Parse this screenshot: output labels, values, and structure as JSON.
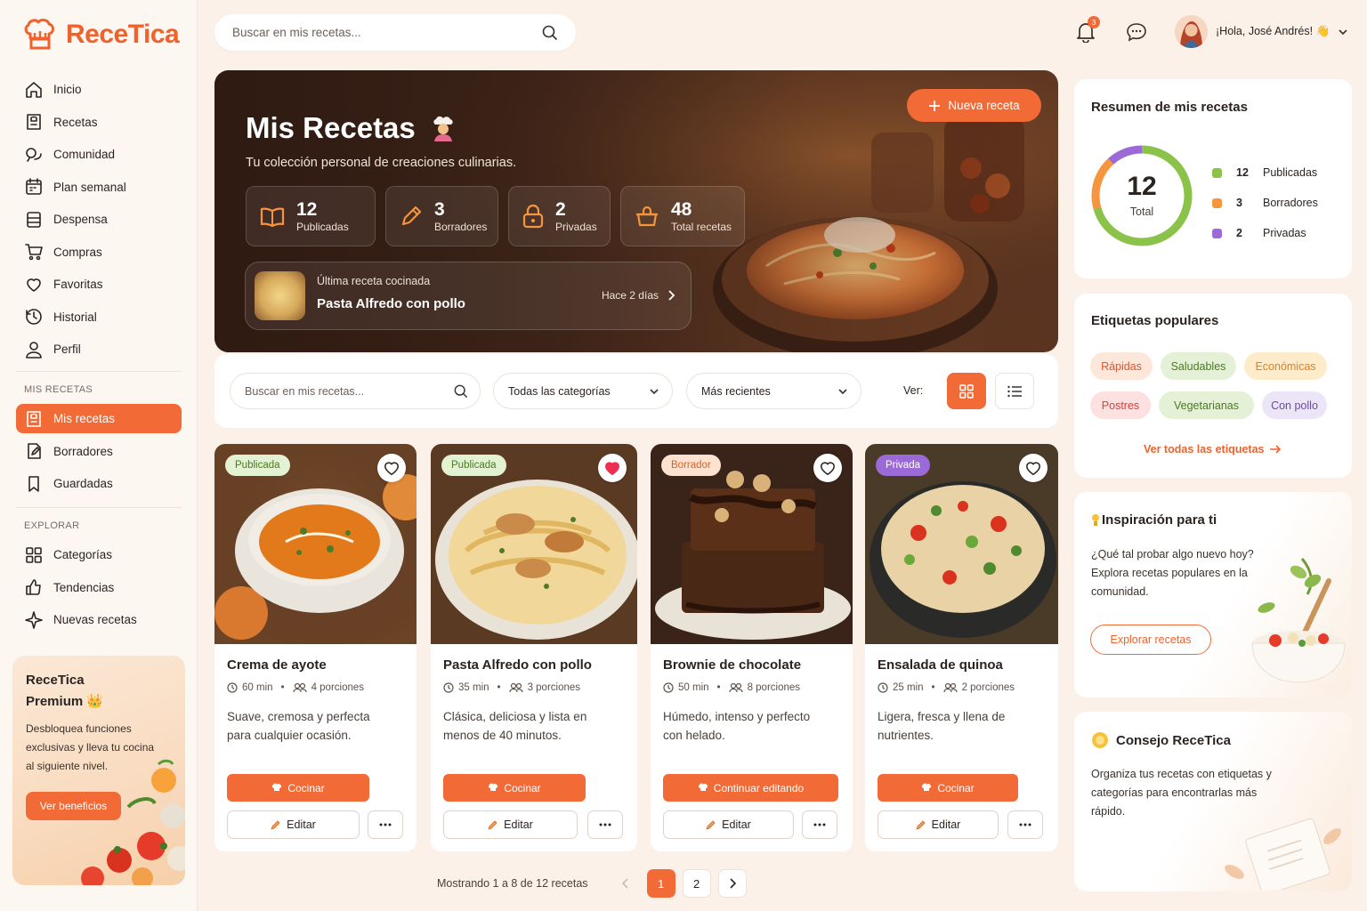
{
  "app": {
    "name": "ReceTica",
    "accent": "#f26a36"
  },
  "sidebar": {
    "main_items": [
      {
        "label": "Inicio",
        "icon": "home-icon"
      },
      {
        "label": "Recetas",
        "icon": "recipes-icon"
      },
      {
        "label": "Comunidad",
        "icon": "community-icon"
      },
      {
        "label": "Plan semanal",
        "icon": "calendar-icon"
      },
      {
        "label": "Despensa",
        "icon": "pantry-icon"
      },
      {
        "label": "Compras",
        "icon": "cart-icon"
      },
      {
        "label": "Favoritas",
        "icon": "heart-icon"
      },
      {
        "label": "Historial",
        "icon": "history-icon"
      },
      {
        "label": "Perfil",
        "icon": "user-icon"
      }
    ],
    "section_mine": "MIS RECETAS",
    "mine_items": [
      {
        "label": "Mis recetas",
        "icon": "recipes-icon",
        "active": true
      },
      {
        "label": "Borradores",
        "icon": "draft-icon"
      },
      {
        "label": "Guardadas",
        "icon": "bookmark-icon"
      }
    ],
    "section_explore": "EXPLORAR",
    "explore_items": [
      {
        "label": "Categorías",
        "icon": "grid-icon"
      },
      {
        "label": "Tendencias",
        "icon": "thumbs-up-icon"
      },
      {
        "label": "Nuevas recetas",
        "icon": "sparkle-icon"
      }
    ],
    "premium": {
      "title": "ReceTica Premium 👑",
      "desc": "Desbloquea funciones exclusivas y lleva tu cocina al siguiente nivel.",
      "button": "Ver beneficios"
    }
  },
  "header": {
    "search_placeholder": "Buscar en mis recetas...",
    "notifications": "3",
    "greeting": "¡Hola, José Andrés! 👋"
  },
  "hero": {
    "title": "Mis Recetas",
    "subtitle": "Tu colección personal de creaciones culinarias.",
    "new_button": "Nueva receta",
    "stats": [
      {
        "value": "12",
        "label": "Publicadas"
      },
      {
        "value": "3",
        "label": "Borradores"
      },
      {
        "value": "2",
        "label": "Privadas"
      },
      {
        "value": "48",
        "label": "Total recetas"
      }
    ],
    "last_cooked": {
      "label": "Última receta cocinada",
      "name": "Pasta Alfredo con pollo",
      "when": "Hace 2 días"
    }
  },
  "filters": {
    "search_placeholder": "Buscar en mis recetas...",
    "category": "Todas las categorías",
    "sort": "Más recientes",
    "view_label": "Ver:"
  },
  "cards": [
    {
      "status": "Publicada",
      "title": "Crema de ayote",
      "time": "60 min",
      "portions": "4 porciones",
      "desc": "Suave, cremosa y perfecta para cualquier ocasión.",
      "primary": "Cocinar",
      "edit": "Editar",
      "favorite": false
    },
    {
      "status": "Publicada",
      "title": "Pasta Alfredo con pollo",
      "time": "35 min",
      "portions": "3 porciones",
      "desc": "Clásica, deliciosa y lista en menos de 40 minutos.",
      "primary": "Cocinar",
      "edit": "Editar",
      "favorite": true
    },
    {
      "status": "Borrador",
      "title": "Brownie de chocolate",
      "time": "50 min",
      "portions": "8 porciones",
      "desc": "Húmedo, intenso y perfecto con helado.",
      "primary": "Continuar editando",
      "edit": "Editar",
      "favorite": false
    },
    {
      "status": "Privada",
      "title": "Ensalada de quinoa",
      "time": "25 min",
      "portions": "2 porciones",
      "desc": "Ligera, fresca y llena de nutrientes.",
      "primary": "Cocinar",
      "edit": "Editar",
      "favorite": false
    }
  ],
  "pagination": {
    "summary": "Mostrando 1 a 8 de 12 recetas",
    "pages": [
      "1",
      "2"
    ],
    "current": "1"
  },
  "summary": {
    "title": "Resumen de mis recetas",
    "total": "12",
    "total_label": "Total",
    "items": [
      {
        "value": "12",
        "label": "Publicadas",
        "color": "#8bc34a"
      },
      {
        "value": "3",
        "label": "Borradores",
        "color": "#f7953f"
      },
      {
        "value": "2",
        "label": "Privadas",
        "color": "#9b6ad6"
      }
    ]
  },
  "tags": {
    "title": "Etiquetas populares",
    "items": [
      "Rápidas",
      "Saludables",
      "Económicas",
      "Postres",
      "Vegetarianas",
      "Con pollo"
    ],
    "link": "Ver todas las etiquetas"
  },
  "inspiration": {
    "title": "Inspiración para ti",
    "text": "¿Qué tal probar algo nuevo hoy? Explora recetas populares en la comunidad.",
    "button": "Explorar recetas"
  },
  "tip": {
    "title": "Consejo ReceTica",
    "text": "Organiza tus recetas con etiquetas y categorías para encontrarlas más rápido."
  }
}
